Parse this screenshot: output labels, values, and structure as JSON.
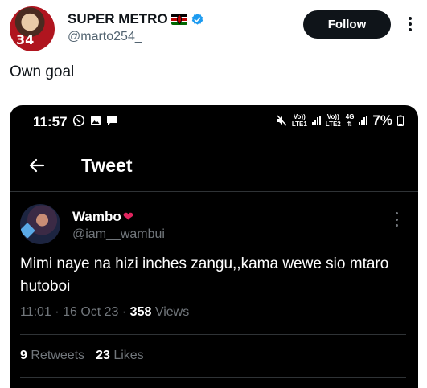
{
  "outer_tweet": {
    "display_name": "SUPER METRO",
    "handle": "@marto254_",
    "follow_label": "Follow",
    "text": "Own goal",
    "avatar_number": "34"
  },
  "screenshot": {
    "status_bar": {
      "time": "11:57",
      "sim1_top": "Vo))",
      "sim1_bottom": "LTE1",
      "sim2_top": "Vo))",
      "sim2_bottom": "LTE2",
      "network": "4G",
      "battery": "7%"
    },
    "screen_title": "Tweet",
    "tweet": {
      "name": "Wambo",
      "name_emoji": "❤",
      "handle": "@iam__wambui",
      "text": "Mimi naye na hizi inches zangu,,kama wewe sio mtaro hutoboi",
      "time": "11:01",
      "date": "16 Oct 23",
      "views_count": "358",
      "views_label": "Views",
      "retweets_count": "9",
      "retweets_label": "Retweets",
      "likes_count": "23",
      "likes_label": "Likes"
    }
  },
  "colors": {
    "follow_bg": "#0f1419",
    "verified": "#1d9bf0",
    "secondary_text": "#536471",
    "dark_bg": "#000000",
    "dark_secondary": "#71767b"
  }
}
